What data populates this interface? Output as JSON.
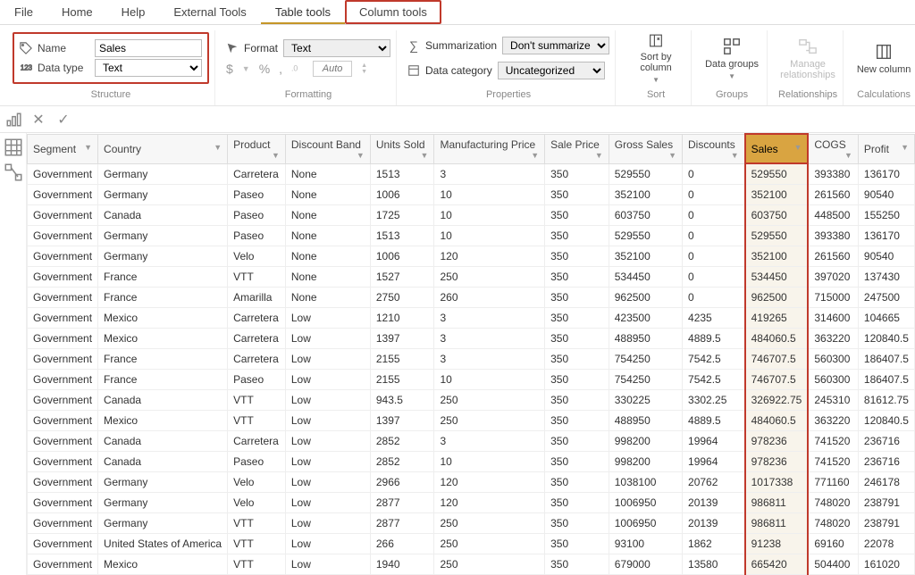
{
  "menu": {
    "file": "File",
    "home": "Home",
    "help": "Help",
    "external_tools": "External Tools",
    "table_tools": "Table tools",
    "column_tools": "Column tools"
  },
  "ribbon": {
    "structure": {
      "group_label": "Structure",
      "name_label": "Name",
      "name_value": "Sales",
      "datatype_label": "Data type",
      "datatype_value": "Text"
    },
    "formatting": {
      "group_label": "Formatting",
      "format_label": "Format",
      "format_value": "Text",
      "auto_placeholder": "Auto",
      "sym_dollar": "$",
      "sym_percent": "%",
      "sym_comma": ","
    },
    "properties": {
      "group_label": "Properties",
      "summarization_label": "Summarization",
      "summarization_value": "Don't summarize",
      "datacategory_label": "Data category",
      "datacategory_value": "Uncategorized"
    },
    "sort": {
      "group_label": "Sort",
      "btn": "Sort by column"
    },
    "groups": {
      "group_label": "Groups",
      "btn": "Data groups"
    },
    "relationships": {
      "group_label": "Relationships",
      "btn": "Manage relationships"
    },
    "calculations": {
      "group_label": "Calculations",
      "btn": "New column"
    }
  },
  "columns": [
    "Segment",
    "Country",
    "Product",
    "Discount Band",
    "Units Sold",
    "Manufacturing Price",
    "Sale Price",
    "Gross Sales",
    "Discounts",
    "Sales",
    "COGS",
    "Profit"
  ],
  "rows": [
    [
      "Government",
      "Germany",
      "Carretera",
      "None",
      "1513",
      "3",
      "350",
      "529550",
      "0",
      "529550",
      "393380",
      "136170"
    ],
    [
      "Government",
      "Germany",
      "Paseo",
      "None",
      "1006",
      "10",
      "350",
      "352100",
      "0",
      "352100",
      "261560",
      "90540"
    ],
    [
      "Government",
      "Canada",
      "Paseo",
      "None",
      "1725",
      "10",
      "350",
      "603750",
      "0",
      "603750",
      "448500",
      "155250"
    ],
    [
      "Government",
      "Germany",
      "Paseo",
      "None",
      "1513",
      "10",
      "350",
      "529550",
      "0",
      "529550",
      "393380",
      "136170"
    ],
    [
      "Government",
      "Germany",
      "Velo",
      "None",
      "1006",
      "120",
      "350",
      "352100",
      "0",
      "352100",
      "261560",
      "90540"
    ],
    [
      "Government",
      "France",
      "VTT",
      "None",
      "1527",
      "250",
      "350",
      "534450",
      "0",
      "534450",
      "397020",
      "137430"
    ],
    [
      "Government",
      "France",
      "Amarilla",
      "None",
      "2750",
      "260",
      "350",
      "962500",
      "0",
      "962500",
      "715000",
      "247500"
    ],
    [
      "Government",
      "Mexico",
      "Carretera",
      "Low",
      "1210",
      "3",
      "350",
      "423500",
      "4235",
      "419265",
      "314600",
      "104665"
    ],
    [
      "Government",
      "Mexico",
      "Carretera",
      "Low",
      "1397",
      "3",
      "350",
      "488950",
      "4889.5",
      "484060.5",
      "363220",
      "120840.5"
    ],
    [
      "Government",
      "France",
      "Carretera",
      "Low",
      "2155",
      "3",
      "350",
      "754250",
      "7542.5",
      "746707.5",
      "560300",
      "186407.5"
    ],
    [
      "Government",
      "France",
      "Paseo",
      "Low",
      "2155",
      "10",
      "350",
      "754250",
      "7542.5",
      "746707.5",
      "560300",
      "186407.5"
    ],
    [
      "Government",
      "Canada",
      "VTT",
      "Low",
      "943.5",
      "250",
      "350",
      "330225",
      "3302.25",
      "326922.75",
      "245310",
      "81612.75"
    ],
    [
      "Government",
      "Mexico",
      "VTT",
      "Low",
      "1397",
      "250",
      "350",
      "488950",
      "4889.5",
      "484060.5",
      "363220",
      "120840.5"
    ],
    [
      "Government",
      "Canada",
      "Carretera",
      "Low",
      "2852",
      "3",
      "350",
      "998200",
      "19964",
      "978236",
      "741520",
      "236716"
    ],
    [
      "Government",
      "Canada",
      "Paseo",
      "Low",
      "2852",
      "10",
      "350",
      "998200",
      "19964",
      "978236",
      "741520",
      "236716"
    ],
    [
      "Government",
      "Germany",
      "Velo",
      "Low",
      "2966",
      "120",
      "350",
      "1038100",
      "20762",
      "1017338",
      "771160",
      "246178"
    ],
    [
      "Government",
      "Germany",
      "Velo",
      "Low",
      "2877",
      "120",
      "350",
      "1006950",
      "20139",
      "986811",
      "748020",
      "238791"
    ],
    [
      "Government",
      "Germany",
      "VTT",
      "Low",
      "2877",
      "250",
      "350",
      "1006950",
      "20139",
      "986811",
      "748020",
      "238791"
    ],
    [
      "Government",
      "United States of America",
      "VTT",
      "Low",
      "266",
      "250",
      "350",
      "93100",
      "1862",
      "91238",
      "69160",
      "22078"
    ],
    [
      "Government",
      "Mexico",
      "VTT",
      "Low",
      "1940",
      "250",
      "350",
      "679000",
      "13580",
      "665420",
      "504400",
      "161020"
    ]
  ]
}
